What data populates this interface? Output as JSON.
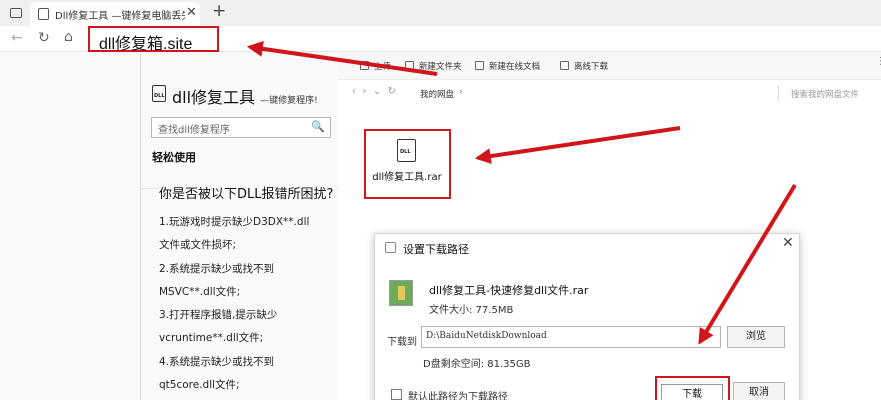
{
  "browser": {
    "tab_title": "Dll修复工具 —键修复电脑丢失D",
    "tab_close": "✕",
    "new_tab": "+",
    "address": "dll修复箱.site"
  },
  "site": {
    "title": "dll修复工具",
    "subtitle": "—键修复程序!",
    "search_placeholder": "查找dll修复程序",
    "section_heading": "轻松使用",
    "question": "你是否被以下DLL报错所困扰?",
    "issues": [
      "1.玩游戏时提示缺少D3DX**.dll",
      "文件或文件损坏;",
      "2.系统提示缺少或找不到",
      "MSVC**.dll文件;",
      "3.打开程序报错,提示缺少",
      "vcruntime**.dll文件;",
      "4.系统提示缺少或找不到",
      "qt5core.dll文件;"
    ]
  },
  "drive": {
    "toolbar": {
      "upload": "上传",
      "new_folder": "新建文件夹",
      "new_doc": "新建在线文档",
      "offline_download": "离线下载"
    },
    "path": "我的网盘",
    "search_placeholder": "搜索我的网盘文件",
    "file": {
      "name": "dll修复工具.rar",
      "icon_text": "DLL"
    }
  },
  "dialog": {
    "title": "设置下载路径",
    "file_name": "dll修复工具-快速修复dll文件.rar",
    "file_size": "文件大小: 77.5MB",
    "download_to_label": "下载到",
    "path_value": "D:\\BaiduNetdiskDownload",
    "browse": "浏览",
    "free_space": "D盘剩余空间: 81.35GB",
    "default_path_label": "默认此路径为下载路径",
    "download": "下载",
    "cancel": "取消"
  },
  "colors": {
    "highlight": "#d0161a",
    "arrow": "#d0161a"
  }
}
